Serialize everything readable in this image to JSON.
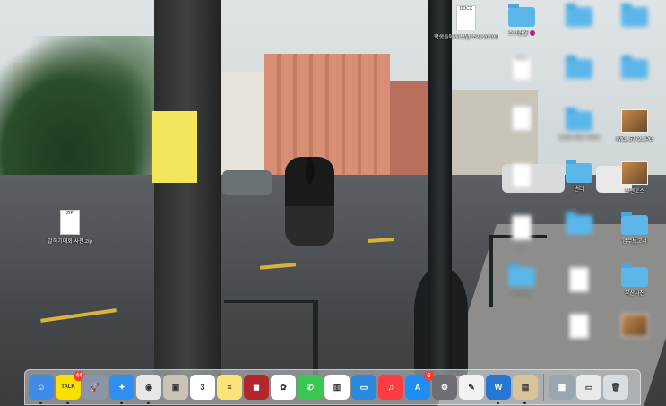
{
  "desktop": {
    "icons": [
      {
        "kind": "doc",
        "label": "학생들에게 보낼 소개 2019.DOCX",
        "doc_text": "DOCX"
      },
      {
        "kind": "folder",
        "label": "스크린샷",
        "tag_color": "#b0287e"
      },
      {
        "kind": "folder",
        "label": "",
        "blurred": true
      },
      {
        "kind": "folder",
        "label": "",
        "blurred": true
      },
      {
        "kind": "doc",
        "label": "",
        "doc_text": "DOCX",
        "blurred": true
      },
      {
        "kind": "folder",
        "label": "",
        "blurred": true
      },
      {
        "kind": "folder",
        "label": "",
        "blurred": true
      },
      {
        "kind": "doc",
        "label": "",
        "blurred": true
      },
      {
        "kind": "folder",
        "label": "100년 영화 사진전",
        "blurred": true
      },
      {
        "kind": "image",
        "label": "IMG_5772.JPG"
      },
      {
        "kind": "doc",
        "label": "",
        "blurred": true
      },
      {
        "kind": "folder",
        "label": "번디"
      },
      {
        "kind": "image",
        "label": "모멘토스"
      },
      {
        "kind": "zip",
        "label": "말하기대회 사진.zip",
        "doc_text": "ZIP"
      },
      {
        "kind": "doc",
        "label": "3",
        "blurred": true
      },
      {
        "kind": "folder",
        "label": "",
        "blurred": true
      },
      {
        "kind": "folder",
        "label": "업무보고서"
      },
      {
        "kind": "folder",
        "label": "보도자료",
        "blurred": true
      },
      {
        "kind": "doc",
        "label": "",
        "blurred": true
      },
      {
        "kind": "folder",
        "label": "부산사진"
      },
      {
        "kind": "doc",
        "label": "",
        "blurred": true
      },
      {
        "kind": "image",
        "label": "",
        "blurred": true
      }
    ]
  },
  "dock": {
    "apps": [
      {
        "name": "finder",
        "color": "#3f8be8",
        "glyph": "☺",
        "running": true
      },
      {
        "name": "kakaotalk",
        "color": "#f9e000",
        "glyph": "TALK",
        "badge": "44",
        "running": true
      },
      {
        "name": "launchpad",
        "color": "#8a96a8",
        "glyph": "🚀"
      },
      {
        "name": "safari",
        "color": "#2e8ff0",
        "glyph": "✦",
        "running": true
      },
      {
        "name": "chrome",
        "color": "#e7e7e7",
        "glyph": "◉",
        "running": true
      },
      {
        "name": "image-capture",
        "color": "#c9c3b5",
        "glyph": "▣"
      },
      {
        "name": "calendar",
        "color": "#ffffff",
        "glyph": "3"
      },
      {
        "name": "notes",
        "color": "#fbe37a",
        "glyph": "≡"
      },
      {
        "name": "photo-booth",
        "color": "#b3262b",
        "glyph": "◼"
      },
      {
        "name": "photos",
        "color": "#ffffff",
        "glyph": "✿"
      },
      {
        "name": "facetime",
        "color": "#3bc651",
        "glyph": "✆"
      },
      {
        "name": "numbers",
        "color": "#ffffff",
        "glyph": "▥"
      },
      {
        "name": "keynote",
        "color": "#2b89e0",
        "glyph": "▭"
      },
      {
        "name": "music",
        "color": "#fc3c44",
        "glyph": "♫"
      },
      {
        "name": "app-store",
        "color": "#1e8ef5",
        "glyph": "A",
        "badge": "6"
      },
      {
        "name": "system-preferences",
        "color": "#6e6e73",
        "glyph": "⚙"
      },
      {
        "name": "textedit",
        "color": "#f2f2f2",
        "glyph": "✎"
      },
      {
        "name": "hancom-word",
        "color": "#2776d3",
        "glyph": "W",
        "running": true
      },
      {
        "name": "preview",
        "color": "#d8c39a",
        "glyph": "▤",
        "running": true
      }
    ],
    "stack_items": [
      {
        "name": "downloads-stack",
        "color": "#9aa5ae",
        "glyph": "▦"
      },
      {
        "name": "documents-stack",
        "color": "#e9e9e9",
        "glyph": "▭"
      },
      {
        "name": "trash",
        "color": "#d8dde1",
        "glyph": "🗑"
      }
    ]
  }
}
